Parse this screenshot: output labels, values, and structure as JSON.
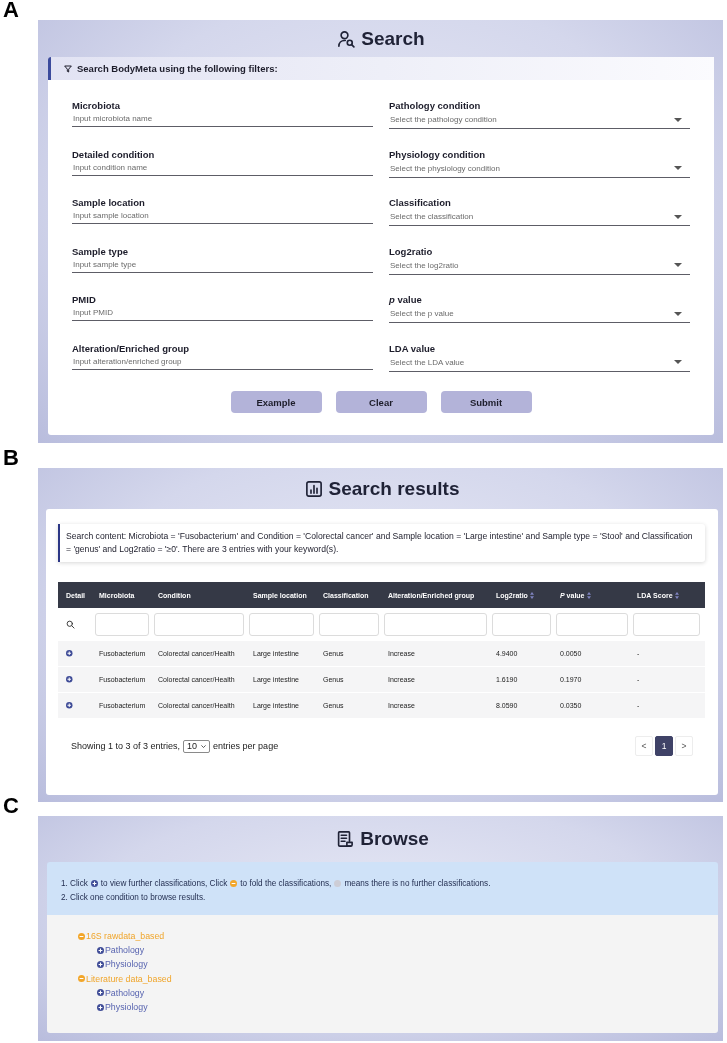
{
  "search_panel": {
    "label": "A",
    "title": "Search",
    "filter_heading": "Search BodyMeta using the following filters:",
    "fields": [
      {
        "kind": "input",
        "label": "Microbiota",
        "placeholder": "Input microbiota name"
      },
      {
        "kind": "select",
        "label": "Pathology condition",
        "placeholder": "Select the pathology condition"
      },
      {
        "kind": "input",
        "label": "Detailed condition",
        "placeholder": "Input condition name"
      },
      {
        "kind": "select",
        "label": "Physiology condition",
        "placeholder": "Select the physiology condition"
      },
      {
        "kind": "input",
        "label": "Sample location",
        "placeholder": "Input sample location"
      },
      {
        "kind": "select",
        "label": "Classification",
        "placeholder": "Select the classification"
      },
      {
        "kind": "input",
        "label": "Sample type",
        "placeholder": "Input sample type"
      },
      {
        "kind": "select",
        "label": "Log2ratio",
        "placeholder": "Select the log2ratio"
      },
      {
        "kind": "input",
        "label": "PMID",
        "placeholder": "Input PMID"
      },
      {
        "kind": "select",
        "label": "*p* value",
        "placeholder": "Select the p value"
      },
      {
        "kind": "input",
        "label": "Alteration/Enriched group",
        "placeholder": "Input alteration/enriched group"
      },
      {
        "kind": "select",
        "label": "LDA value",
        "placeholder": "Select the LDA value"
      }
    ],
    "buttons": [
      "Example",
      "Clear",
      "Submit"
    ]
  },
  "results_panel": {
    "label": "B",
    "title": "Search results",
    "summary": "Search content: Microbiota = 'Fusobacterium' and Condition = 'Colorectal cancer' and Sample location = 'Large intestine' and Sample type = 'Stool' and Classification = 'genus' and Log2ratio = '≥0'. There are 3 entries with your keyword(s).",
    "table": {
      "columns": [
        {
          "label": "Detail",
          "sortable": false
        },
        {
          "label": "Microbiota",
          "sortable": false
        },
        {
          "label": "Condition",
          "sortable": false
        },
        {
          "label": "Sample location",
          "sortable": false
        },
        {
          "label": "Classification",
          "sortable": false
        },
        {
          "label": "Alteration/Enriched group",
          "sortable": false
        },
        {
          "label": "Log2ratio",
          "sortable": true
        },
        {
          "label": "*P* value",
          "sortable": true
        },
        {
          "label": "LDA Score",
          "sortable": true
        }
      ],
      "rows": [
        {
          "expanded": false,
          "cells": [
            "",
            "Fusobacterium",
            "Colorectal cancer/Health",
            "Large intestine",
            "Genus",
            "Increase",
            "4.9400",
            "0.0050",
            "-"
          ]
        },
        {
          "expanded": false,
          "cells": [
            "",
            "Fusobacterium",
            "Colorectal cancer/Health",
            "Large intestine",
            "Genus",
            "Increase",
            "1.6190",
            "0.1970",
            "-"
          ]
        },
        {
          "expanded": false,
          "cells": [
            "",
            "Fusobacterium",
            "Colorectal cancer/Health",
            "Large intestine",
            "Genus",
            "Increase",
            "8.0590",
            "0.0350",
            "-"
          ]
        }
      ]
    },
    "footer": {
      "before": "Showing 1 to 3 of 3 entries,",
      "page_size": "10",
      "after": "entries per page"
    },
    "pagination": [
      {
        "label": "<",
        "selected": false
      },
      {
        "label": "1",
        "selected": true
      },
      {
        "label": ">",
        "selected": false
      }
    ]
  },
  "browse_panel": {
    "label": "C",
    "title": "Browse",
    "instructions": [
      {
        "parts": [
          {
            "kind": "text",
            "text": "1. Click"
          },
          {
            "kind": "expand"
          },
          {
            "kind": "text",
            "text": "to view further classifications, Click"
          },
          {
            "kind": "fold"
          },
          {
            "kind": "text",
            "text": "to fold the classifications,"
          },
          {
            "kind": "leaf"
          },
          {
            "kind": "text",
            "text": "means there is no further classifications."
          }
        ]
      },
      {
        "parts": [
          {
            "kind": "text",
            "text": "2. Click one condition to browse results."
          }
        ]
      }
    ],
    "tree": [
      {
        "label": "16S rawdata_based",
        "expanded": true,
        "children": [
          {
            "label": "Pathology",
            "expanded": false
          },
          {
            "label": "Physiology",
            "expanded": false
          }
        ]
      },
      {
        "label": "Literature data_based",
        "expanded": true,
        "children": [
          {
            "label": "Pathology",
            "expanded": false
          },
          {
            "label": "Physiology",
            "expanded": false
          }
        ]
      }
    ]
  }
}
